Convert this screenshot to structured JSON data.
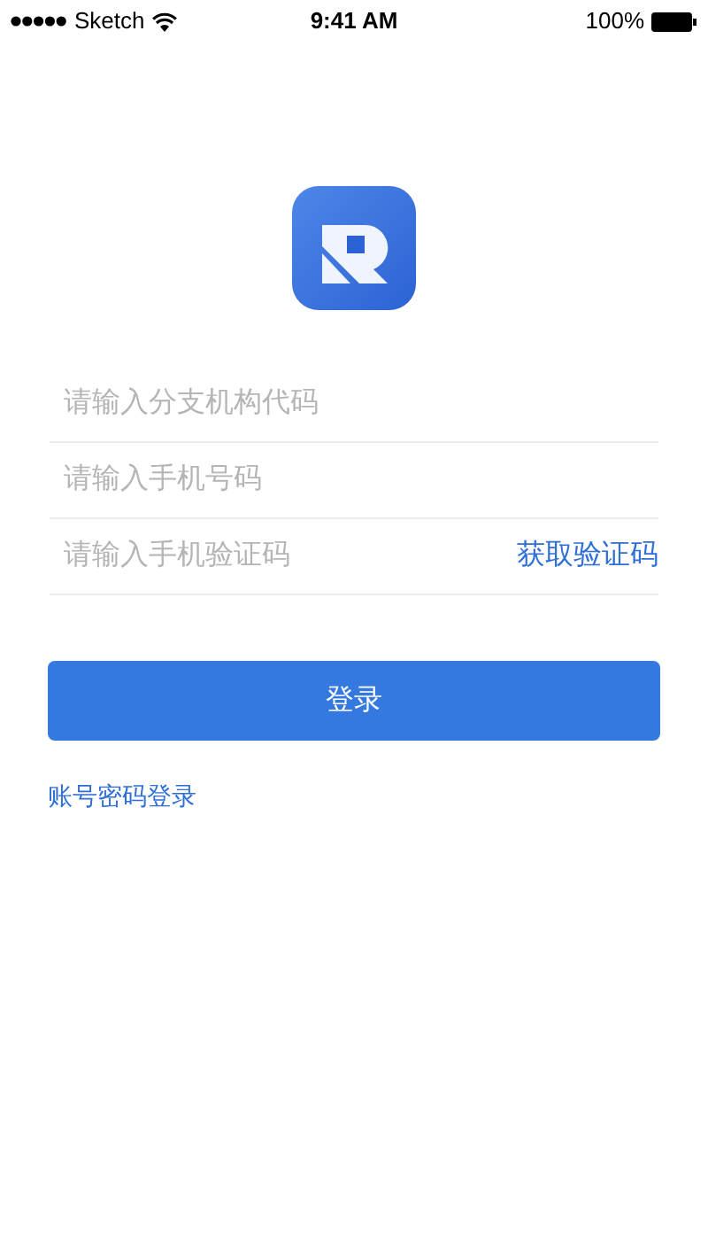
{
  "status_bar": {
    "carrier": "Sketch",
    "time": "9:41 AM",
    "battery": "100%"
  },
  "fields": [
    {
      "placeholder": "请输入分支机构代码"
    },
    {
      "placeholder": "请输入手机号码"
    },
    {
      "placeholder": "请输入手机验证码",
      "action": "获取验证码"
    }
  ],
  "login_button": "登录",
  "alt_login_link": "账号密码登录"
}
